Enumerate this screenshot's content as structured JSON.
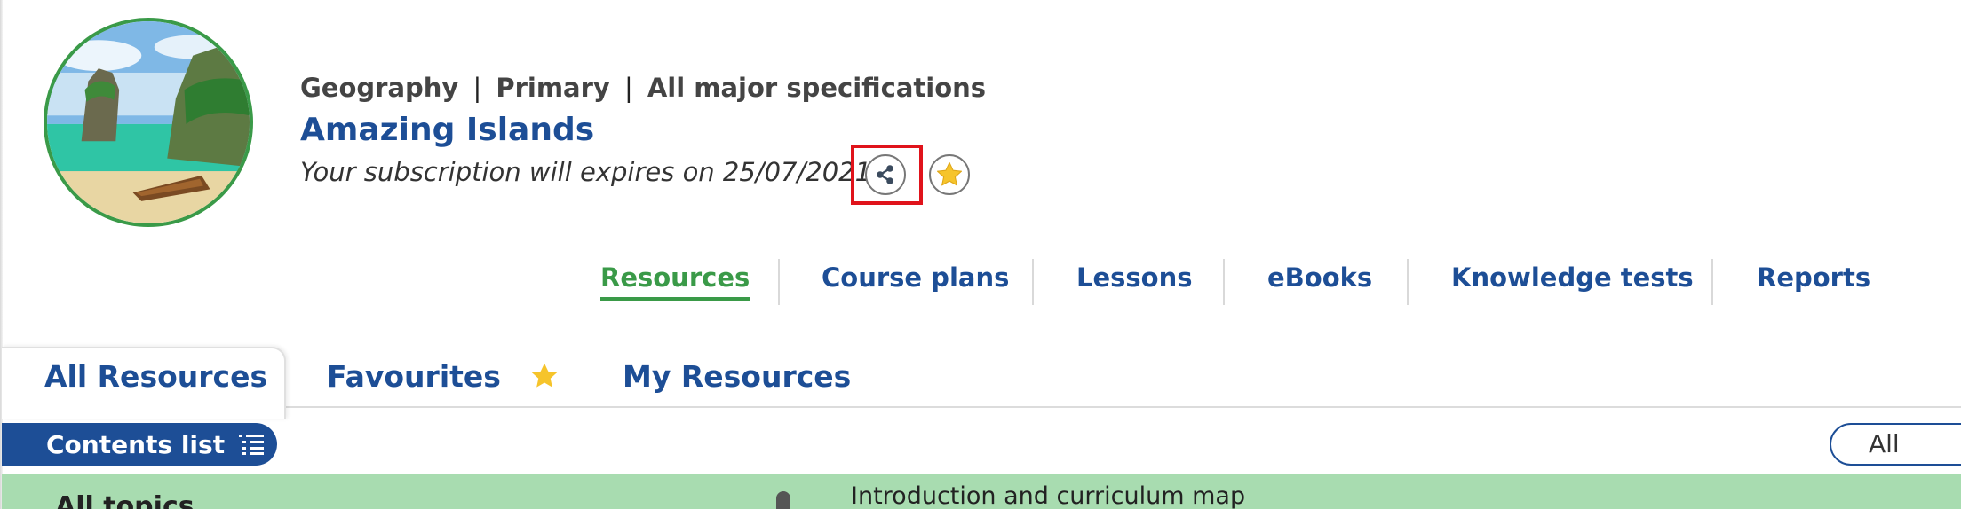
{
  "header": {
    "breadcrumb": {
      "subject": "Geography",
      "level": "Primary",
      "spec": "All major specifications",
      "separator": "|"
    },
    "title": "Amazing Islands",
    "subscription_text": "Your subscription will expires on 25/07/2021"
  },
  "icons": {
    "share": "share-icon",
    "favourite": "star-icon",
    "list": "list-icon"
  },
  "section_nav": [
    {
      "label": "Resources",
      "active": true
    },
    {
      "label": "Course plans",
      "active": false
    },
    {
      "label": "Lessons",
      "active": false
    },
    {
      "label": "eBooks",
      "active": false
    },
    {
      "label": "Knowledge tests",
      "active": false
    },
    {
      "label": "Reports",
      "active": false
    }
  ],
  "tabs": [
    {
      "label": "All Resources",
      "active": true
    },
    {
      "label": "Favourites",
      "active": false
    },
    {
      "label": "My Resources",
      "active": false
    }
  ],
  "contents": {
    "button_label": "Contents list",
    "filter_value": "All"
  },
  "topics": {
    "heading": "All topics",
    "first_item": "Introduction and curriculum map"
  },
  "colors": {
    "brand_blue": "#1d4e96",
    "active_green": "#3a9a48",
    "highlight_red": "#e0131b",
    "star_yellow": "#f6c42b",
    "strip_green": "#a8dcb0"
  }
}
